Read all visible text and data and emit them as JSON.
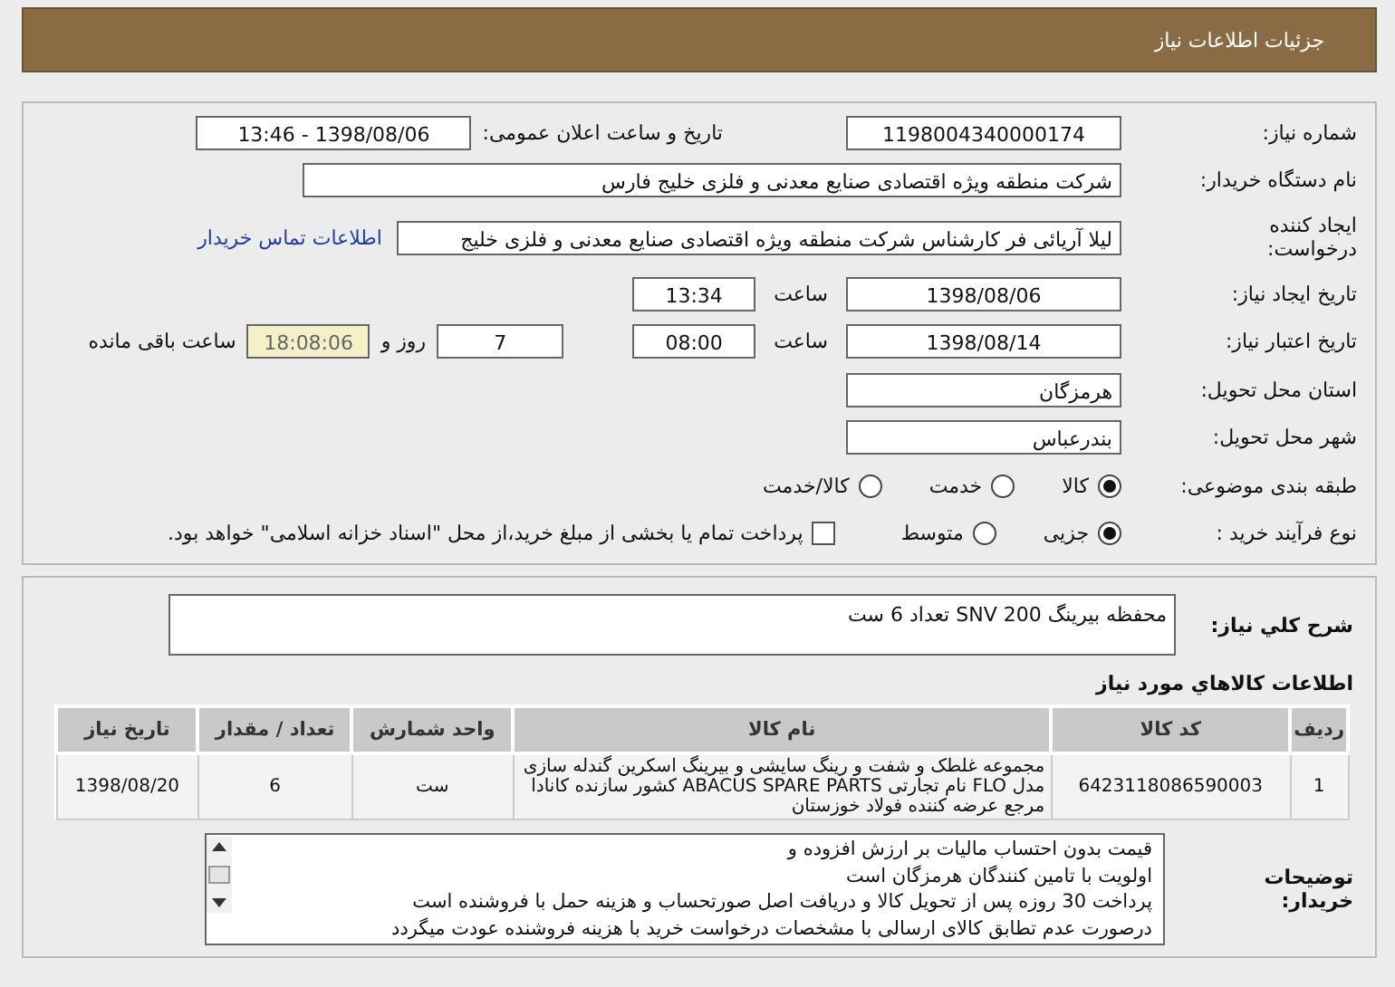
{
  "header": {
    "title": "جزئیات اطلاعات نیاز"
  },
  "need_number": {
    "label": "شماره نیاز:",
    "value": "1198004340000174"
  },
  "announce": {
    "label": "تاریخ و ساعت اعلان عمومی:",
    "value": "1398/08/06 - 13:46"
  },
  "buyer": {
    "label": "نام دستگاه خریدار:",
    "value": "شرکت منطقه ویژه اقتصادی صنایع معدنی و فلزی خلیج فارس"
  },
  "requester": {
    "label": "ایجاد کننده درخواست:",
    "value": "لیلا آریائی فر کارشناس شرکت منطقه ویژه اقتصادی صنایع معدنی و فلزی خلیج",
    "link": "اطلاعات تماس خریدار"
  },
  "created": {
    "label": "تاریخ ایجاد نیاز:",
    "date": "1398/08/06",
    "time_label": "ساعت",
    "time": "13:34"
  },
  "validity": {
    "label": "تاریخ اعتبار نیاز:",
    "date": "1398/08/14",
    "time_label": "ساعت",
    "time": "08:00",
    "days": "7",
    "days_label": "روز و",
    "remaining": "18:08:06",
    "remaining_label": "ساعت باقی مانده"
  },
  "province": {
    "label": "استان محل تحویل:",
    "value": "هرمزگان"
  },
  "city": {
    "label": "شهر محل تحویل:",
    "value": "بندرعباس"
  },
  "category": {
    "label": "طبقه بندی موضوعی:",
    "options": [
      {
        "label": "کالا",
        "selected": true
      },
      {
        "label": "خدمت",
        "selected": false
      },
      {
        "label": "کالا/خدمت",
        "selected": false
      }
    ]
  },
  "process": {
    "label": "نوع فرآیند خرید :",
    "options": [
      {
        "label": "جزیی",
        "selected": true
      },
      {
        "label": "متوسط",
        "selected": false
      }
    ],
    "treasury": {
      "label": "پرداخت تمام یا بخشی از مبلغ خرید،از محل \"اسناد خزانه اسلامی\" خواهد بود.",
      "checked": false
    }
  },
  "description": {
    "label": "شرح کلي نياز:",
    "value": "محفظه بیرینگ SNV 200 تعداد 6 ست"
  },
  "goods": {
    "title": "اطلاعات کالاهاي مورد نياز",
    "columns": [
      "رديف",
      "کد کالا",
      "نام کالا",
      "واحد شمارش",
      "تعداد / مقدار",
      "تاریخ نیاز"
    ],
    "rows": [
      [
        "1",
        "6423118086590003",
        "مجموعه غلطک و شفت و رینگ سایشی و بیرینگ اسکرین گندله سازی مدل FLO نام تجارتی ABACUS SPARE PARTS کشور سازنده کانادا مرجع عرضه کننده فولاد خوزستان",
        "ست",
        "6",
        "1398/08/20"
      ]
    ]
  },
  "notes": {
    "label": "توضیحات خریدار:",
    "lines": [
      "قیمت بدون احتساب مالیات بر ارزش افزوده و",
      "اولویت با تامین کنندگان هرمزگان است",
      "پرداخت 30 روزه پس از تحویل کالا و دریافت اصل صورتحساب و هزینه حمل با فروشنده است",
      "درصورت عدم تطابق کالای ارسالی با مشخصات درخواست خرید با هزینه فروشنده عودت میگردد"
    ]
  }
}
